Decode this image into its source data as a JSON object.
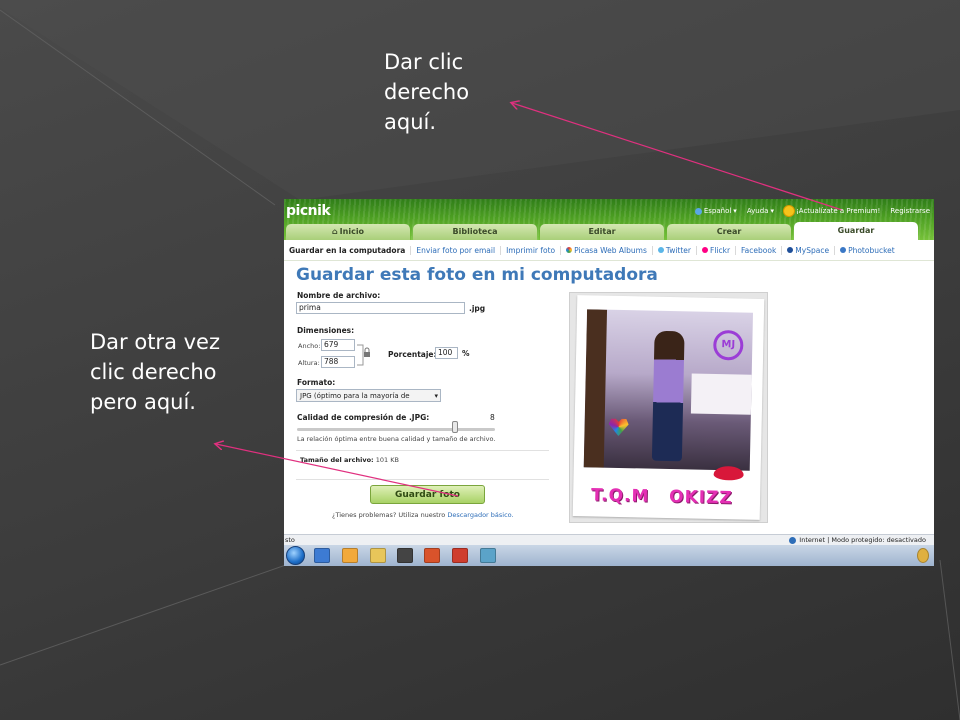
{
  "slide": {
    "callout_top": [
      "Dar clic",
      "derecho",
      "aquí."
    ],
    "callout_left": [
      "Dar otra vez",
      "clic derecho",
      "pero aquí."
    ]
  },
  "app": {
    "logo": "picnik",
    "top_menu": {
      "language": "Español",
      "help": "Ayuda",
      "premium": "¡Actualízate a Premium!",
      "register": "Registrarse"
    },
    "tabs": [
      {
        "label": "Inicio",
        "icon": "home-icon"
      },
      {
        "label": "Biblioteca"
      },
      {
        "label": "Editar"
      },
      {
        "label": "Crear"
      },
      {
        "label": "Guardar",
        "active": true
      }
    ],
    "subnav": [
      {
        "label": "Guardar en la computadora",
        "current": true
      },
      {
        "label": "Enviar foto por email"
      },
      {
        "label": "Imprimir foto"
      },
      {
        "label": "Picasa Web Albums",
        "icon": "picasa-icon"
      },
      {
        "label": "Twitter",
        "icon": "twitter-icon"
      },
      {
        "label": "Flickr",
        "icon": "flickr-icon"
      },
      {
        "label": "Facebook"
      },
      {
        "label": "MySpace",
        "icon": "myspace-icon"
      },
      {
        "label": "Photobucket",
        "icon": "photobucket-icon"
      }
    ],
    "form": {
      "title": "Guardar esta foto en mi computadora",
      "filename_label": "Nombre de archivo:",
      "filename_value": "prima",
      "filename_ext": ".jpg",
      "dimensions_label": "Dimensiones:",
      "width_label": "Ancho:",
      "width_value": "679",
      "height_label": "Altura:",
      "height_value": "788",
      "percent_label": "Porcentaje:",
      "percent_value": "100",
      "percent_unit": "%",
      "format_label": "Formato:",
      "format_value": "JPG (óptimo para la mayoría de",
      "quality_label": "Calidad de compresión de .JPG:",
      "quality_value": "8",
      "quality_fraction": 0.8,
      "quality_hint": "La relación óptima entre buena calidad y tamaño de archivo.",
      "filesize_label": "Tamaño del archivo:",
      "filesize_value": "101 KB",
      "save_button": "Guardar foto",
      "help_text": "¿Tienes problemas? Utiliza nuestro",
      "help_link": "Descargador básico."
    },
    "photo": {
      "badge": "MJ",
      "caption_left": "T.Q.M",
      "caption_right": "OKIZZ"
    },
    "statusbar": {
      "left": "sto",
      "zone": "Internet | Modo protegido: desactivado"
    }
  },
  "colors": {
    "slide_background": "#3f3f3f",
    "callout_text": "#ffffff",
    "arrow": "#e0307f",
    "title_blue": "#3f79b8",
    "caption_pink": "#e42fb4"
  }
}
